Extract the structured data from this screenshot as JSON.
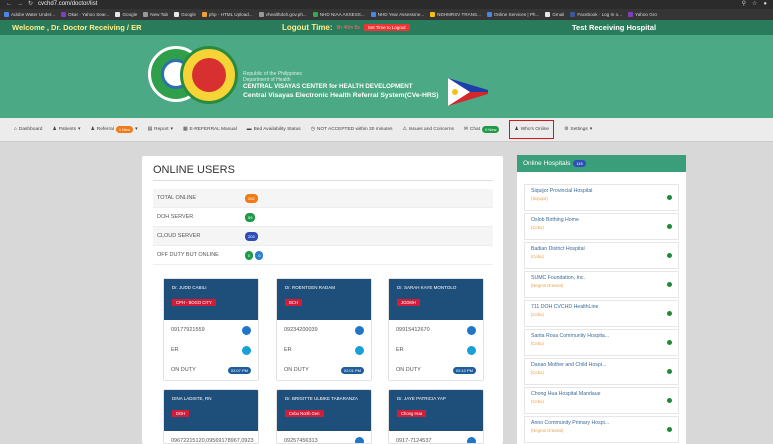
{
  "browser": {
    "url": "cvchd7.com/doctor/list",
    "bookmarks": [
      "Adobe Water Under...",
      "Okar · Yahoo Sear...",
      "Google",
      "New Tab",
      "Google",
      "php - HTML Upload...",
      "vhealthdoh.gov.ph...",
      "NHD NIAA ASSESS...",
      "NHD Year Assessme...",
      "NDHMRSV TRANS...",
      "Online Services | Ph...",
      "Gmail",
      "Facebook · Log In o...",
      "Yahoo Gro"
    ]
  },
  "topbar": {
    "welcome": "Welcome , Dr. Doctor Receiving / ER",
    "logout_label": "Logout Time:",
    "logout_time": "9h 40m 8s",
    "logout_button": "Set Time to Logout",
    "hospital": "Test Receiving Hospital"
  },
  "banner": {
    "line1": "Republic of the Philippines",
    "line2": "Department of Health",
    "line3": "CENTRAL VISAYAS CENTER for HEALTH DEVELOPMENT",
    "line4": "Central Visayas Electronic Health Referral System(CVe-HRS)"
  },
  "nav": [
    {
      "label": "Dashboard",
      "icon": "home-icon"
    },
    {
      "label": "Patients",
      "icon": "users-icon",
      "caret": true
    },
    {
      "label": "Referral",
      "icon": "user-icon",
      "badge": "1 New",
      "badge_color": "#f07a18",
      "caret": true
    },
    {
      "label": "Report",
      "icon": "chart-icon",
      "caret": true
    },
    {
      "label": "E-REFERRAL Manual",
      "icon": "book-icon"
    },
    {
      "label": "Bed Availability Status",
      "icon": "bed-icon"
    },
    {
      "label": "NOT ACCEPTED within 30 minutes",
      "icon": "clock-icon"
    },
    {
      "label": "Issues and Concerns",
      "icon": "warning-icon"
    },
    {
      "label": "Chat",
      "icon": "chat-icon",
      "badge": "0 New",
      "badge_color": "#1f9a48"
    },
    {
      "label": "Who's Online",
      "icon": "user-online-icon",
      "active": true
    },
    {
      "label": "Settings",
      "icon": "gear-icon",
      "caret": true
    }
  ],
  "online_users": {
    "title": "ONLINE USERS",
    "stats": [
      {
        "label": "TOTAL ONLINE",
        "count": "262",
        "color": "#f07a18"
      },
      {
        "label": "DOH SERVER",
        "count": "59",
        "color": "#1f9a48"
      },
      {
        "label": "CLOUD SERVER",
        "count": "203",
        "color": "#2d4fb5"
      },
      {
        "label": "OFF DUTY BUT ONLINE",
        "counts": [
          "0",
          "0"
        ],
        "colors": [
          "#1f9a48",
          "#2d7fc9"
        ]
      }
    ],
    "cards": [
      {
        "name": "Dr. JUDD CABILI",
        "tag": "CPH - BOGO CITY",
        "phone": "09177921559",
        "dept": "ER",
        "status": "ON DUTY",
        "time": "02:07 PM"
      },
      {
        "name": "Dr. ROENTGEN RADAM",
        "tag": "BCH",
        "phone": "09234200039",
        "dept": "ER",
        "status": "ON DUTY",
        "time": "02:01 PM"
      },
      {
        "name": "Dr. SARAH KAYE MONTOLO",
        "tag": "JGDMH",
        "phone": "09915412670",
        "dept": "ER",
        "status": "ON DUTY",
        "time": "02:10 PM"
      },
      {
        "name": "DINA LADISTE, RN",
        "tag": "DOH",
        "phone": "09672215120,09569178967,0923"
      },
      {
        "name": "Dr. BRIGITTE ULBIKE TABARANZA",
        "tag": "Cebu North Gen",
        "phone": "09257456313"
      },
      {
        "name": "Dr. JAYE PATRICIA YAP",
        "tag": "Chong Hua",
        "phone": "0917-7124537"
      }
    ]
  },
  "online_hospitals": {
    "title": "Online Hospitals",
    "count": "115",
    "items": [
      {
        "name": "Siquijor Provincial Hospital",
        "province": "(Siquijor)"
      },
      {
        "name": "Oslob Birthing Home",
        "province": "(Cebu)"
      },
      {
        "name": "Badian District Hospital",
        "province": "(Cebu)"
      },
      {
        "name": "SUMC Foundation, Inc.",
        "province": "(Negros Oriental)"
      },
      {
        "name": "711 DOH CVCHD HealthLine",
        "province": "(Cebu)"
      },
      {
        "name": "Santa Rosa Community Hospita...",
        "province": "(Cebu)"
      },
      {
        "name": "Danao Mother and Child Hospi...",
        "province": "(Cebu)"
      },
      {
        "name": "Chong Hua Hospital Mandaue",
        "province": "(Cebu)"
      },
      {
        "name": "Anno Community Primary Hospi...",
        "province": "(Negros Oriental)"
      }
    ]
  }
}
